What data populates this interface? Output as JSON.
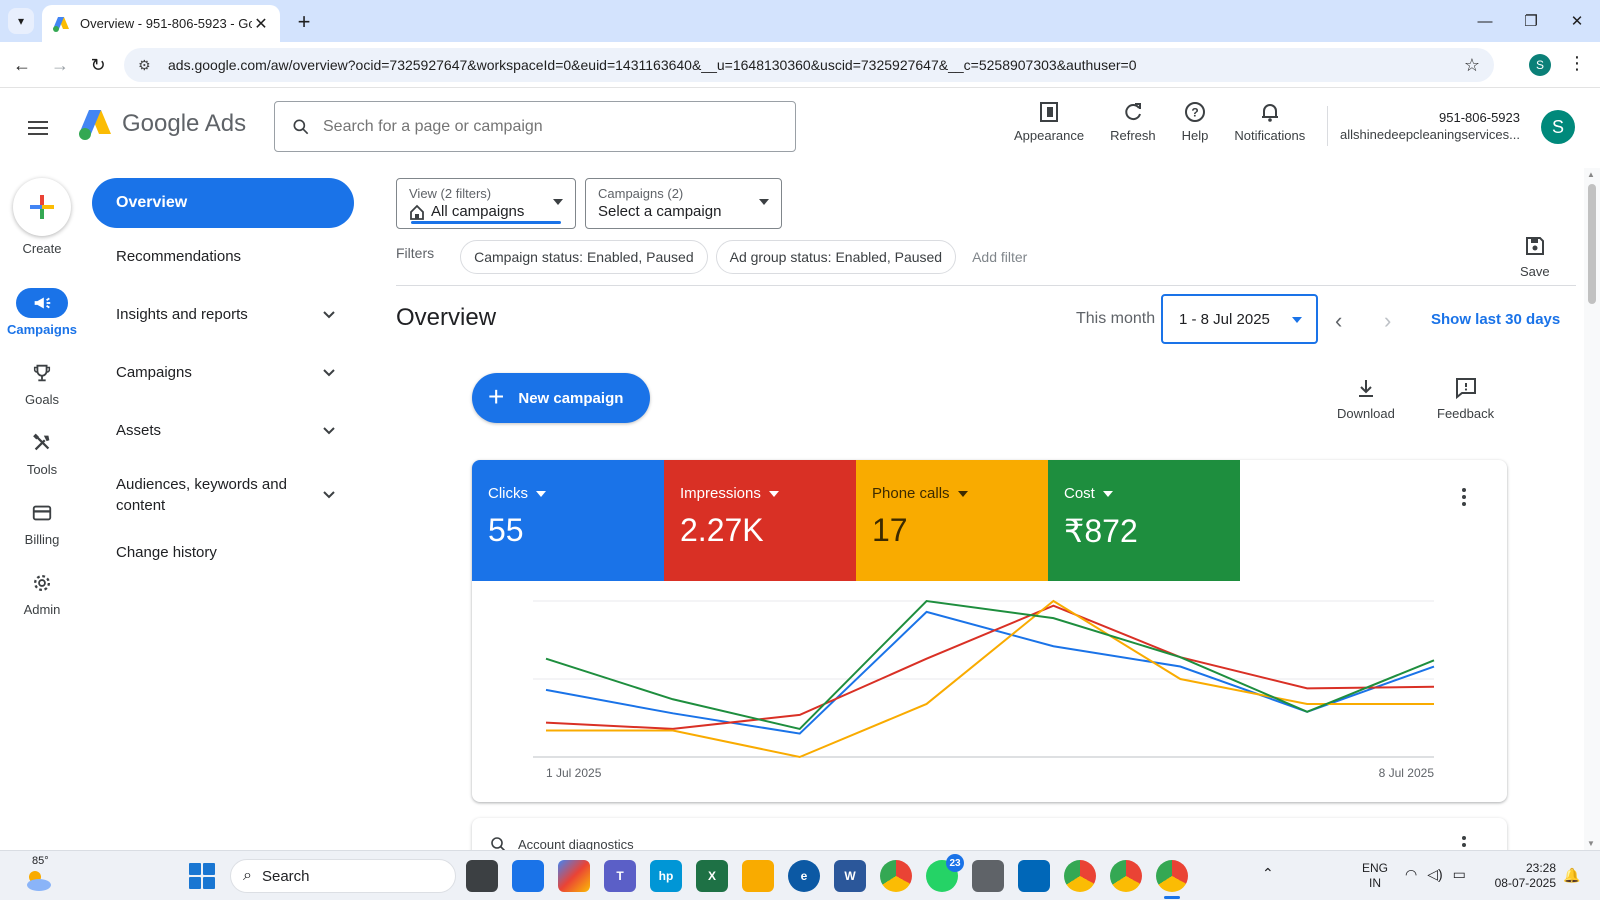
{
  "browser": {
    "tab_title": "Overview - 951-806-5923 - Goo",
    "url": "ads.google.com/aw/overview?ocid=7325927647&workspaceId=0&euid=1431163640&__u=1648130360&uscid=7325927647&__c=5258907303&authuser=0",
    "profile_initial": "S"
  },
  "header": {
    "logo_text": "Google Ads",
    "search_placeholder": "Search for a page or campaign",
    "actions": {
      "appearance": "Appearance",
      "refresh": "Refresh",
      "help": "Help",
      "notifications": "Notifications"
    },
    "account_id": "951-806-5923",
    "account_name": "allshinedeepcleaningservices...",
    "avatar_initial": "S"
  },
  "rail": {
    "create": "Create",
    "items": [
      {
        "label": "Campaigns",
        "icon": "megaphone-icon",
        "active": true
      },
      {
        "label": "Goals",
        "icon": "trophy-icon"
      },
      {
        "label": "Tools",
        "icon": "tools-icon"
      },
      {
        "label": "Billing",
        "icon": "credit-card-icon"
      },
      {
        "label": "Admin",
        "icon": "gear-icon"
      }
    ]
  },
  "sidenav": {
    "overview": "Overview",
    "items": [
      {
        "label": "Recommendations",
        "expandable": false
      },
      {
        "label": "Insights and reports",
        "expandable": true
      },
      {
        "label": "Campaigns",
        "expandable": true
      },
      {
        "label": "Assets",
        "expandable": true
      },
      {
        "label": "Audiences, keywords and content",
        "expandable": true
      },
      {
        "label": "Change history",
        "expandable": false
      }
    ]
  },
  "selectors": {
    "view_small": "View (2 filters)",
    "view_value": "All campaigns",
    "campaigns_small": "Campaigns (2)",
    "campaigns_value": "Select a campaign"
  },
  "filters": {
    "label": "Filters",
    "chips": [
      "Campaign status: Enabled, Paused",
      "Ad group status: Enabled, Paused"
    ],
    "add_filter": "Add filter",
    "save": "Save"
  },
  "overview": {
    "title": "Overview",
    "this_month": "This month",
    "date_range": "1 - 8 Jul 2025",
    "show_last": "Show last 30 days",
    "new_campaign": "New campaign",
    "download": "Download",
    "feedback": "Feedback"
  },
  "metrics": [
    {
      "label": "Clicks",
      "value": "55",
      "color": "#1a73e8"
    },
    {
      "label": "Impressions",
      "value": "2.27K",
      "color": "#d93025"
    },
    {
      "label": "Phone calls",
      "value": "17",
      "color": "#f9ab00"
    },
    {
      "label": "Cost",
      "value": "₹872",
      "color": "#1e8e3e"
    }
  ],
  "chart_data": {
    "type": "line",
    "x": [
      "1 Jul 2025",
      "2 Jul 2025",
      "3 Jul 2025",
      "4 Jul 2025",
      "5 Jul 2025",
      "6 Jul 2025",
      "7 Jul 2025",
      "8 Jul 2025"
    ],
    "x_tick_labels": [
      "1 Jul 2025",
      "8 Jul 2025"
    ],
    "ylim": [
      0,
      100
    ],
    "y_axis_note": "normalized per-series, no y tick labels shown",
    "grid": true,
    "series": [
      {
        "metric": "Clicks",
        "color": "#1a73e8",
        "values": [
          43,
          28,
          15,
          93,
          71,
          58,
          29,
          58
        ]
      },
      {
        "metric": "Impressions",
        "color": "#d93025",
        "values": [
          22,
          18,
          27,
          63,
          97,
          64,
          44,
          45
        ]
      },
      {
        "metric": "Phone calls",
        "color": "#f9ab00",
        "values": [
          17,
          17,
          0,
          34,
          100,
          50,
          34,
          34
        ]
      },
      {
        "metric": "Cost",
        "color": "#1e8e3e",
        "values": [
          63,
          37,
          18,
          100,
          89,
          64,
          29,
          62
        ]
      }
    ]
  },
  "diagnostics": {
    "title": "Account diagnostics"
  },
  "taskbar": {
    "weather_temp": "85°",
    "search": "Search",
    "whatsapp_badge": "23",
    "lang_top": "ENG",
    "lang_bottom": "IN",
    "time": "23:28",
    "date": "08-07-2025"
  }
}
